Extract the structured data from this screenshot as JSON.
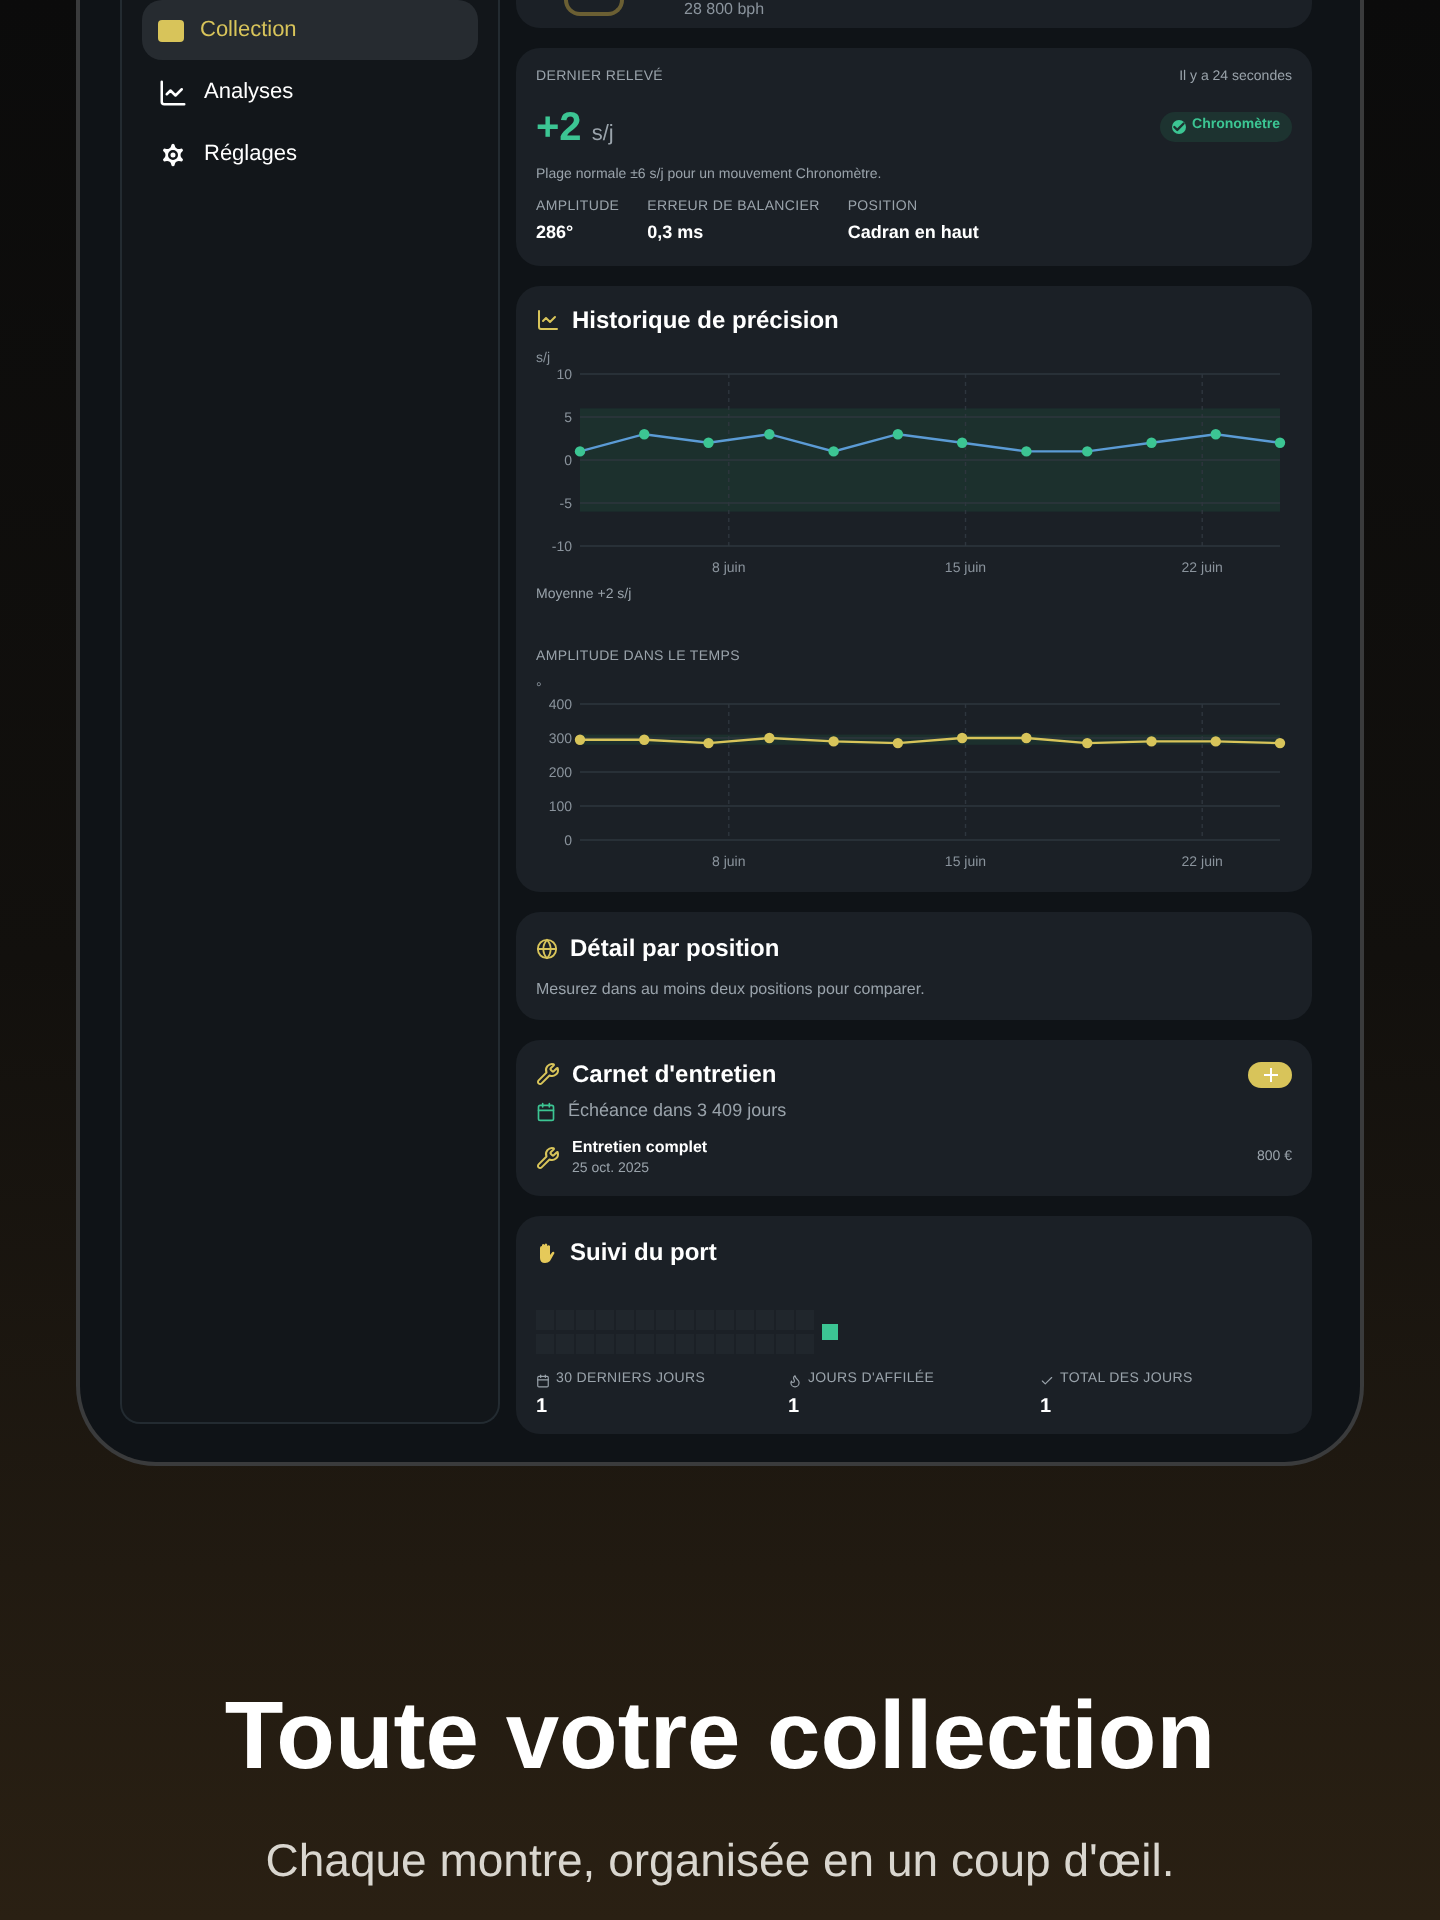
{
  "sidebar": {
    "items": [
      {
        "label": "Collection",
        "selected": true
      },
      {
        "label": "Analyses",
        "selected": false
      },
      {
        "label": "Réglages",
        "selected": false
      }
    ]
  },
  "watch_header": {
    "beat_rate": "28 800 bph"
  },
  "last_reading": {
    "title": "DERNIER RELEVÉ",
    "time": "Il y a 24 secondes",
    "value": "+2",
    "unit": "s/j",
    "badge": "Chronomètre",
    "note": "Plage normale ±6 s/j pour un mouvement Chronomètre.",
    "stats": [
      {
        "label": "AMPLITUDE",
        "value": "286°"
      },
      {
        "label": "ERREUR DE BALANCIER",
        "value": "0,3 ms"
      },
      {
        "label": "POSITION",
        "value": "Cadran en haut"
      }
    ]
  },
  "precision_history": {
    "title": "Historique de précision",
    "chart_data": {
      "type": "line",
      "ylabel": "s/j",
      "x": [
        3.6,
        5.5,
        7.4,
        9.2,
        11.1,
        13,
        14.9,
        16.8,
        18.6,
        20.5,
        22.4,
        24.3
      ],
      "series": [
        {
          "color": "#5b9bd5",
          "marker": true,
          "values": [
            1,
            3,
            2,
            3,
            1,
            3,
            2,
            1,
            1,
            2,
            3,
            2
          ]
        }
      ],
      "grid": true,
      "xlim": [
        3.6,
        24.3
      ],
      "ylim": [
        -10,
        10
      ],
      "yticks": [
        10,
        5,
        0,
        -5,
        -10
      ],
      "xticks": [
        {
          "value": 8,
          "label": "8 juin"
        },
        {
          "value": 15,
          "label": "15 juin"
        },
        {
          "value": 22,
          "label": "22 juin"
        }
      ],
      "bands": [
        {
          "axis": "y",
          "from": -6,
          "to": 6
        }
      ]
    },
    "average": "Moyenne +2 s/j"
  },
  "amplitude_history": {
    "title": "AMPLITUDE DANS LE TEMPS",
    "chart_data": {
      "type": "line",
      "ylabel": "°",
      "x": [
        3.6,
        5.5,
        7.4,
        9.2,
        11.1,
        13,
        14.9,
        16.8,
        18.6,
        20.5,
        22.4,
        24.3
      ],
      "series": [
        {
          "color": "#d8c45a",
          "marker": true,
          "values": [
            295,
            295,
            285,
            300,
            290,
            285,
            300,
            300,
            285,
            290,
            290,
            285
          ]
        }
      ],
      "grid": true,
      "xlim": [
        3.6,
        24.3
      ],
      "ylim": [
        0,
        400
      ],
      "yticks": [
        400,
        300,
        200,
        100,
        0
      ],
      "xticks": [
        {
          "value": 8,
          "label": "8 juin"
        },
        {
          "value": 15,
          "label": "15 juin"
        },
        {
          "value": 22,
          "label": "22 juin"
        }
      ],
      "bands": [
        {
          "axis": "y",
          "from": 280,
          "to": 310
        }
      ]
    }
  },
  "position_detail": {
    "title": "Détail par position",
    "message": "Mesurez dans au moins deux positions pour comparer."
  },
  "service_log": {
    "title": "Carnet d'entretien",
    "due": "Échéance dans 3 409 jours",
    "entries": [
      {
        "name": "Entretien complet",
        "date": "25 oct. 2025",
        "cost": "800 €"
      }
    ]
  },
  "wear_tracking": {
    "title": "Suivi du port",
    "stats": [
      {
        "label": "30 DERNIERS JOURS",
        "value": "1"
      },
      {
        "label": "JOURS D'AFFILÉE",
        "value": "1"
      },
      {
        "label": "TOTAL DES JOURS",
        "value": "1"
      }
    ]
  },
  "headline": "Toute votre collection",
  "subtitle": "Chaque montre, organisée en un coup d'œil."
}
